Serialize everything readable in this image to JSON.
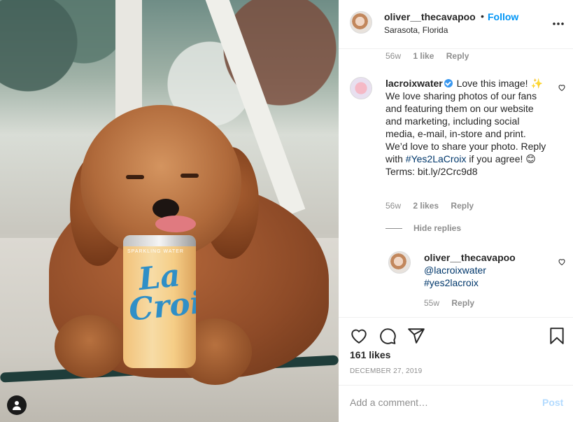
{
  "post": {
    "username": "oliver__thecavapoo",
    "follow_label": "Follow",
    "dot": "•",
    "location": "Sarasota, Florida",
    "likes": "161 likes",
    "date": "DECEMBER 27, 2019",
    "can_brand": "La Croix",
    "can_text": "SPARKLING WATER"
  },
  "prev_comment_meta": {
    "time": "56w",
    "likes": "1 like",
    "reply": "Reply"
  },
  "comments": [
    {
      "username": "lacroixwater",
      "text_before": " Love this image! ✨ We love sharing photos of our fans and featuring them on our website and marketing, including social media, e-mail, in-store and print. We’d love to share your photo. Reply with ",
      "hashtag": "#Yes2LaCroix",
      "text_after": " if you agree! 😊 Terms: bit.ly/2Crc9d8",
      "time": "56w",
      "likes": "2 likes",
      "reply": "Reply"
    }
  ],
  "hide_replies": "Hide replies",
  "reply": {
    "username": "oliver__thecavapoo",
    "mention": "@lacroixwater",
    "hashtag": "#yes2lacroix",
    "time": "55w",
    "reply": "Reply"
  },
  "composer": {
    "placeholder": "Add a comment…",
    "post_label": "Post"
  },
  "colors": {
    "accent": "#0095f6",
    "post_disabled": "#b3dbff",
    "link": "#00376b"
  }
}
